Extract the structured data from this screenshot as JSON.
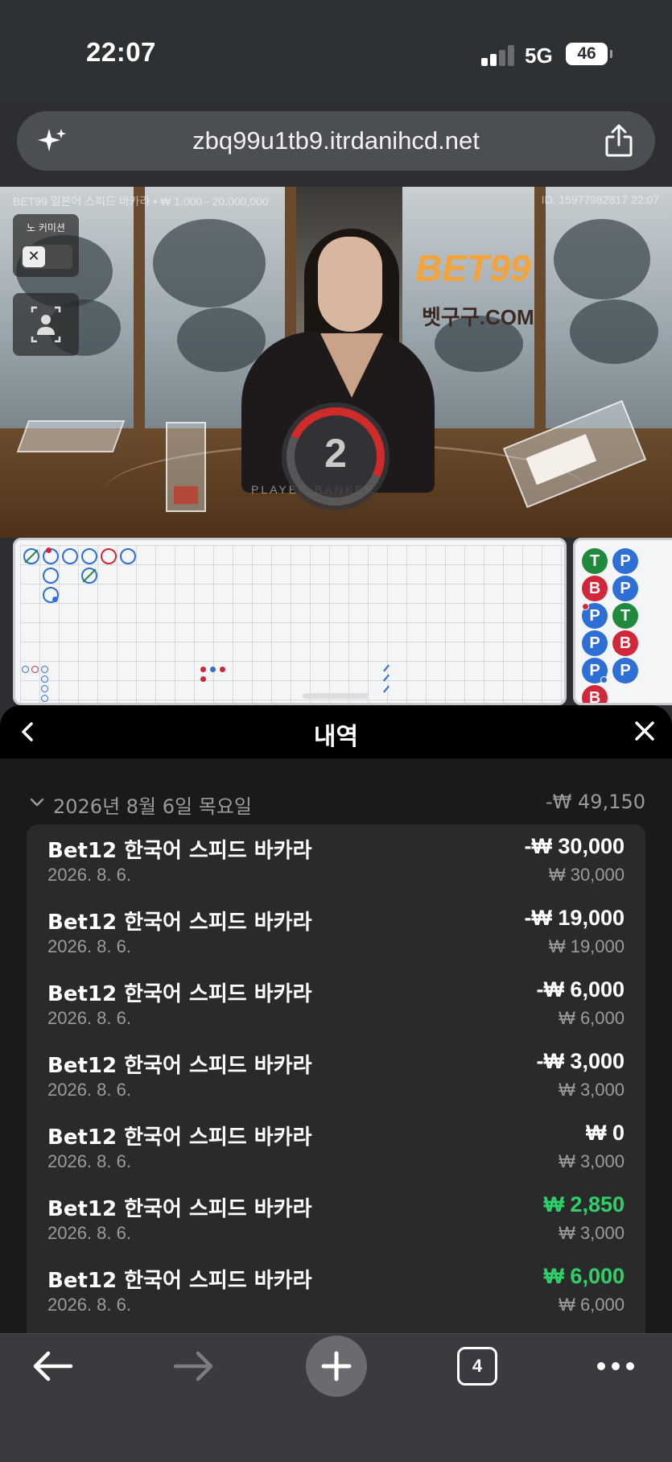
{
  "status_bar": {
    "time": "22:07",
    "network": "5G",
    "battery": "46"
  },
  "browser": {
    "url": "zbq99u1tb9.itrdanihcd.net",
    "tab_count": "4"
  },
  "video": {
    "info": "BET99 일본어 스피드 바카라 • ₩ 1,000 - 20,000,000",
    "id": "ID: 15977982817 22:07",
    "no_commission_label": "노 커미션",
    "logo": "BET99",
    "logo_sub": "벳구구.COM",
    "table_text": "PLAYER   BANKER",
    "timer": "2"
  },
  "bead_road": [
    [
      "T",
      "P"
    ],
    [
      "B",
      "P"
    ],
    [
      "P",
      "T"
    ],
    [
      "P",
      "B"
    ],
    [
      "P",
      "P"
    ],
    [
      "B",
      ""
    ]
  ],
  "history": {
    "title": "내역",
    "day": {
      "date": "2026년 8월 6일 목요일",
      "total": "-₩ 49,150"
    },
    "items": [
      {
        "name": "Bet12 한국어 스피드 바카라",
        "date": "2026. 8. 6.",
        "amount": "-₩ 30,000",
        "stake": "₩ 30,000",
        "win": false
      },
      {
        "name": "Bet12 한국어 스피드 바카라",
        "date": "2026. 8. 6.",
        "amount": "-₩ 19,000",
        "stake": "₩ 19,000",
        "win": false
      },
      {
        "name": "Bet12 한국어 스피드 바카라",
        "date": "2026. 8. 6.",
        "amount": "-₩ 6,000",
        "stake": "₩ 6,000",
        "win": false
      },
      {
        "name": "Bet12 한국어 스피드 바카라",
        "date": "2026. 8. 6.",
        "amount": "-₩ 3,000",
        "stake": "₩ 3,000",
        "win": false
      },
      {
        "name": "Bet12 한국어 스피드 바카라",
        "date": "2026. 8. 6.",
        "amount": "₩ 0",
        "stake": "₩ 3,000",
        "win": false
      },
      {
        "name": "Bet12 한국어 스피드 바카라",
        "date": "2026. 8. 6.",
        "amount": "₩ 2,850",
        "stake": "₩ 3,000",
        "win": true
      },
      {
        "name": "Bet12 한국어 스피드 바카라",
        "date": "2026. 8. 6.",
        "amount": "₩ 6,000",
        "stake": "₩ 6,000",
        "win": true
      }
    ]
  },
  "colors": {
    "banker": "#d2263a",
    "player": "#2d6fd6",
    "tie": "#1f8a3c",
    "win_amount": "#2fd06a"
  }
}
